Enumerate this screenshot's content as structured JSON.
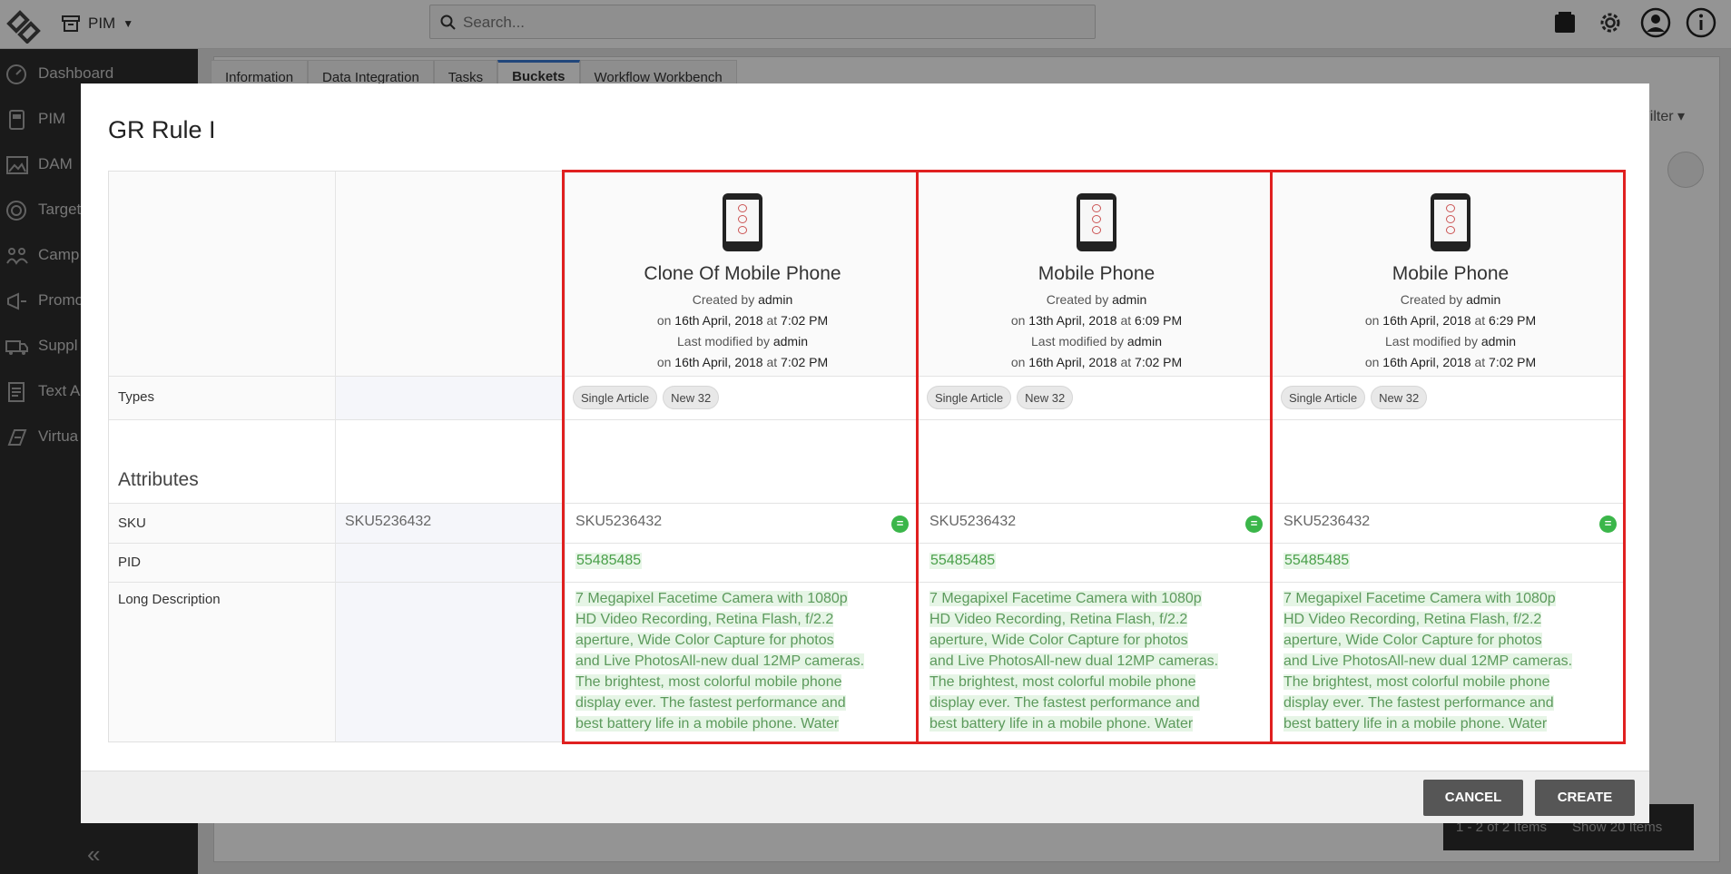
{
  "topbar": {
    "module_label": "PIM",
    "search_placeholder": "Search..."
  },
  "sidebar": {
    "items": [
      {
        "label": "Dashboard",
        "icon": "dashboard-icon"
      },
      {
        "label": "PIM",
        "icon": "pim-icon"
      },
      {
        "label": "DAM",
        "icon": "image-icon"
      },
      {
        "label": "Target",
        "icon": "target-icon"
      },
      {
        "label": "Camp",
        "icon": "campaign-icon"
      },
      {
        "label": "Promo",
        "icon": "megaphone-icon"
      },
      {
        "label": "Suppl",
        "icon": "truck-icon"
      },
      {
        "label": "Text A",
        "icon": "text-icon"
      },
      {
        "label": "Virtua",
        "icon": "virtual-icon"
      }
    ]
  },
  "background": {
    "tabs": [
      "Information",
      "Data Integration",
      "Tasks",
      "Buckets",
      "Workflow Workbench"
    ],
    "active_tab": "Buckets",
    "filter_label": "Filter",
    "pager_range": "1 - 2 of 2 Items",
    "pager_show": "Show 20 Items"
  },
  "modal": {
    "title": "GR Rule I",
    "row_labels": {
      "types": "Types",
      "attributes": "Attributes",
      "sku": "SKU",
      "pid": "PID",
      "long_description": "Long Description"
    },
    "reference_sku": "SKU5236432",
    "products": [
      {
        "name": "Clone Of Mobile Phone",
        "created_prefix": "Created by",
        "created_by": "admin",
        "created_on_prefix": "on",
        "created_date": "16th April, 2018",
        "created_at": "at",
        "created_time": "7:02 PM",
        "modified_prefix": "Last modified by",
        "modified_by": "admin",
        "modified_on_prefix": "on",
        "modified_date": "16th April, 2018",
        "modified_at": "at",
        "modified_time": "7:02 PM",
        "types": [
          "Single Article",
          "New 32"
        ],
        "sku": "SKU5236432",
        "pid": "55485485",
        "long_description": [
          "7 Megapixel Facetime Camera with 1080p",
          "HD Video Recording, Retina Flash, f/2.2",
          "aperture, Wide Color Capture for photos",
          "and Live PhotosAll-new dual 12MP cameras.",
          "The brightest, most colorful mobile phone",
          "display ever. The fastest performance and",
          "best battery life in a mobile phone. Water"
        ]
      },
      {
        "name": "Mobile Phone",
        "created_prefix": "Created by",
        "created_by": "admin",
        "created_on_prefix": "on",
        "created_date": "13th April, 2018",
        "created_at": "at",
        "created_time": "6:09 PM",
        "modified_prefix": "Last modified by",
        "modified_by": "admin",
        "modified_on_prefix": "on",
        "modified_date": "16th April, 2018",
        "modified_at": "at",
        "modified_time": "7:02 PM",
        "types": [
          "Single Article",
          "New 32"
        ],
        "sku": "SKU5236432",
        "pid": "55485485",
        "long_description": [
          "7 Megapixel Facetime Camera with 1080p",
          "HD Video Recording, Retina Flash, f/2.2",
          "aperture, Wide Color Capture for photos",
          "and Live PhotosAll-new dual 12MP cameras.",
          "The brightest, most colorful mobile phone",
          "display ever. The fastest performance and",
          "best battery life in a mobile phone. Water"
        ]
      },
      {
        "name": "Mobile Phone",
        "created_prefix": "Created by",
        "created_by": "admin",
        "created_on_prefix": "on",
        "created_date": "16th April, 2018",
        "created_at": "at",
        "created_time": "6:29 PM",
        "modified_prefix": "Last modified by",
        "modified_by": "admin",
        "modified_on_prefix": "on",
        "modified_date": "16th April, 2018",
        "modified_at": "at",
        "modified_time": "7:02 PM",
        "types": [
          "Single Article",
          "New 32"
        ],
        "sku": "SKU5236432",
        "pid": "55485485",
        "long_description": [
          "7 Megapixel Facetime Camera with 1080p",
          "HD Video Recording, Retina Flash, f/2.2",
          "aperture, Wide Color Capture for photos",
          "and Live PhotosAll-new dual 12MP cameras.",
          "The brightest, most colorful mobile phone",
          "display ever. The fastest performance and",
          "best battery life in a mobile phone. Water"
        ]
      }
    ],
    "buttons": {
      "cancel": "CANCEL",
      "create": "CREATE"
    },
    "colors": {
      "highlight_border": "#e02020",
      "match_badge": "#3bb64a",
      "button": "#565656"
    }
  }
}
